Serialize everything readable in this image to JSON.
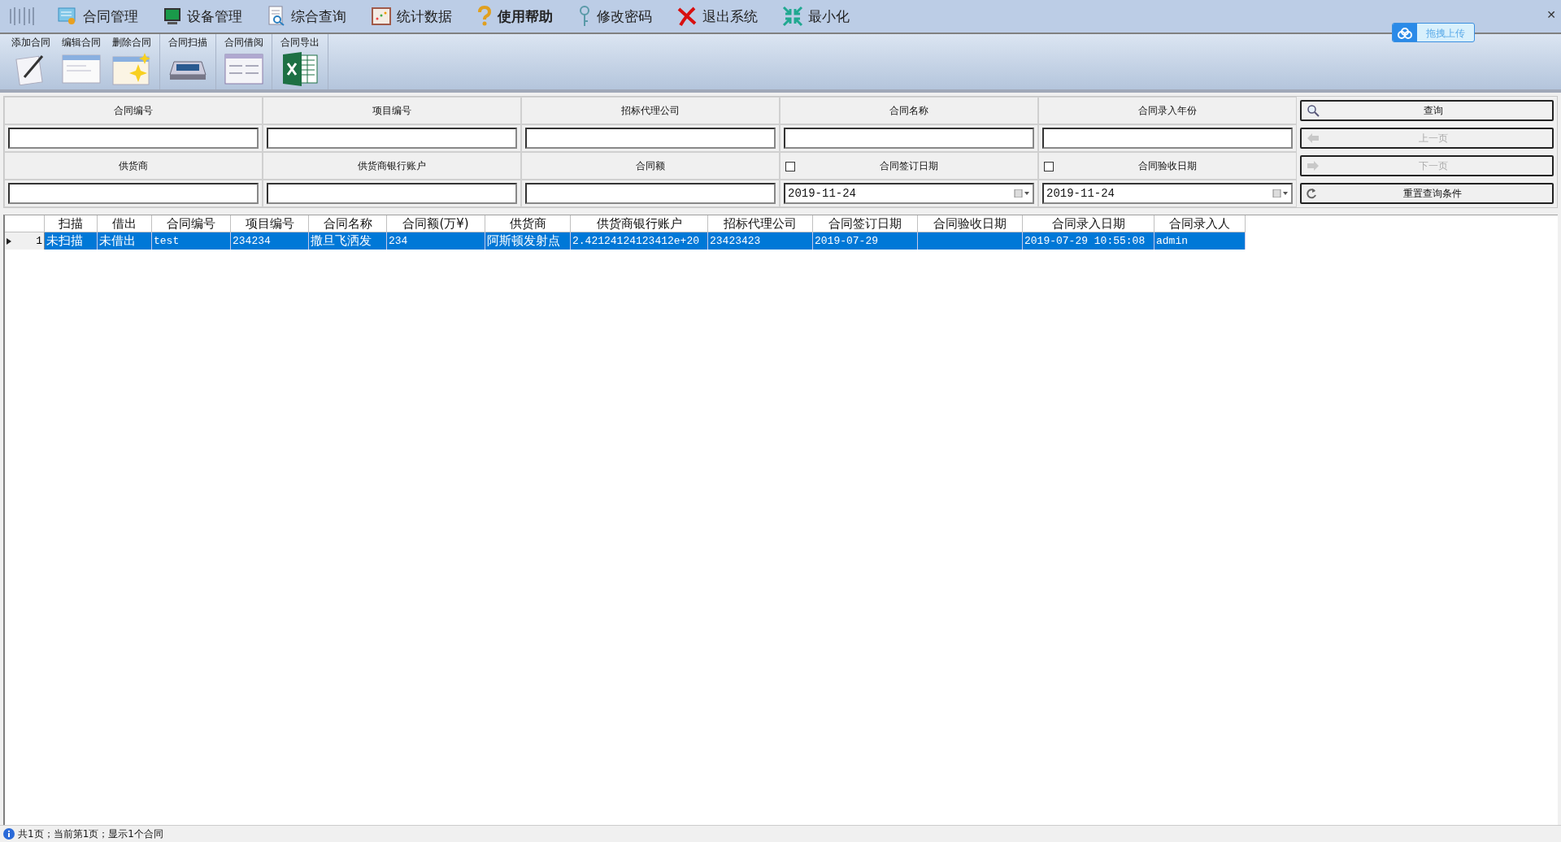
{
  "menu": [
    {
      "label": "合同管理"
    },
    {
      "label": "设备管理"
    },
    {
      "label": "综合查询"
    },
    {
      "label": "统计数据"
    },
    {
      "label": "使用帮助"
    },
    {
      "label": "修改密码"
    },
    {
      "label": "退出系统"
    },
    {
      "label": "最小化"
    }
  ],
  "close_button": "✕",
  "upload_button": "拖拽上传",
  "toolbar": [
    {
      "group": [
        {
          "label": "添加合同"
        },
        {
          "label": "编辑合同"
        },
        {
          "label": "删除合同"
        }
      ]
    },
    {
      "group": [
        {
          "label": "合同扫描"
        }
      ]
    },
    {
      "group": [
        {
          "label": "合同借阅"
        }
      ]
    },
    {
      "group": [
        {
          "label": "合同导出"
        }
      ]
    }
  ],
  "filters": {
    "row1": [
      {
        "label": "合同编号"
      },
      {
        "label": "项目编号"
      },
      {
        "label": "招标代理公司"
      },
      {
        "label": "合同名称"
      },
      {
        "label": "合同录入年份"
      }
    ],
    "row2": [
      {
        "label": "供货商",
        "kind": "text"
      },
      {
        "label": "供货商银行账户",
        "kind": "text"
      },
      {
        "label": "合同额",
        "kind": "text"
      },
      {
        "label": "合同签订日期",
        "kind": "date",
        "checked": false,
        "value": "2019-11-24"
      },
      {
        "label": "合同验收日期",
        "kind": "date",
        "checked": false,
        "value": "2019-11-24"
      }
    ],
    "buttons": [
      {
        "label": "查询",
        "disabled": false
      },
      {
        "label": "上一页",
        "disabled": true
      },
      {
        "label": "下一页",
        "disabled": true
      },
      {
        "label": "重置查询条件",
        "disabled": false
      }
    ]
  },
  "table": {
    "columns": [
      "扫描",
      "借出",
      "合同编号",
      "项目编号",
      "合同名称",
      "合同额(万¥)",
      "供货商",
      "供货商银行账户",
      "招标代理公司",
      "合同签订日期",
      "合同验收日期",
      "合同录入日期",
      "合同录入人"
    ],
    "rows": [
      {
        "number": "1",
        "selected": true,
        "cells": [
          "未扫描",
          "未借出",
          "test",
          "234234",
          "撒旦飞洒发",
          "234",
          "阿斯顿发射点",
          "2.42124124123412e+20",
          "23423423",
          "2019-07-29",
          "",
          "2019-07-29 10:55:08",
          "admin"
        ]
      }
    ]
  },
  "status_bar": "共1页；当前第1页；显示1个合同"
}
